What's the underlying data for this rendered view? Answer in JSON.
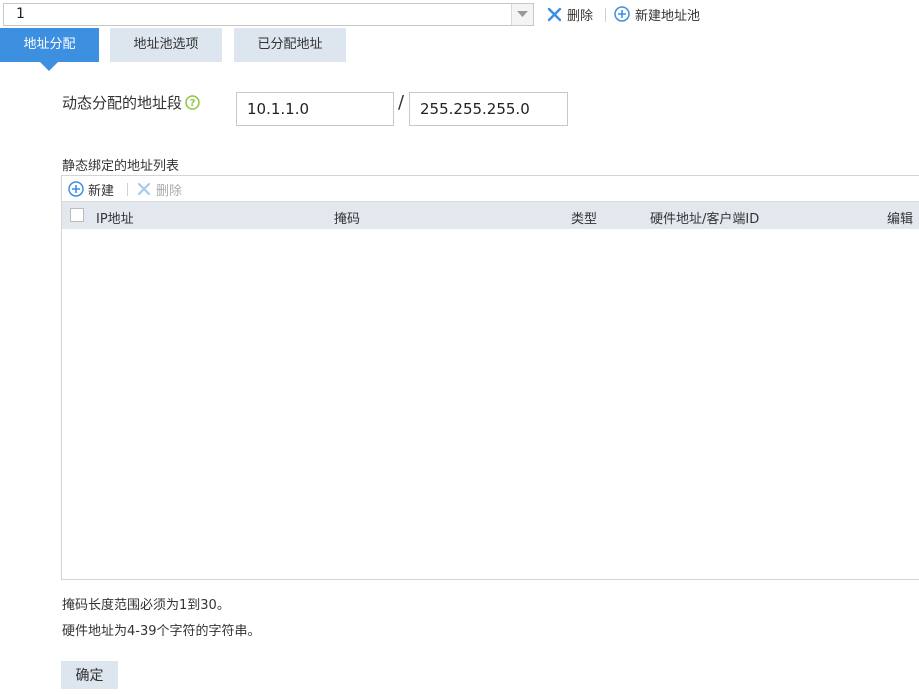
{
  "topbar": {
    "pool_value": "1",
    "delete_label": "删除",
    "new_pool_label": "新建地址池"
  },
  "tabs": [
    {
      "label": "地址分配",
      "active": true
    },
    {
      "label": "地址池选项",
      "active": false
    },
    {
      "label": "已分配地址",
      "active": false
    }
  ],
  "dynamic": {
    "label": "动态分配的地址段",
    "ip": "10.1.1.0",
    "separator": "/",
    "mask": "255.255.255.0"
  },
  "static_list": {
    "title": "静态绑定的地址列表",
    "new_label": "新建",
    "delete_label": "删除",
    "columns": [
      "IP地址",
      "掩码",
      "类型",
      "硬件地址/客户端ID",
      "编辑"
    ],
    "rows": []
  },
  "notes": [
    "掩码长度范围必须为1到30。",
    "硬件地址为4-39个字符的字符串。"
  ],
  "confirm_label": "确定",
  "colors": {
    "accent": "#3d8fe0",
    "tab_inactive": "#dde5ef",
    "delete_icon": "#3d8fe0",
    "help_icon": "#8cc63f"
  }
}
